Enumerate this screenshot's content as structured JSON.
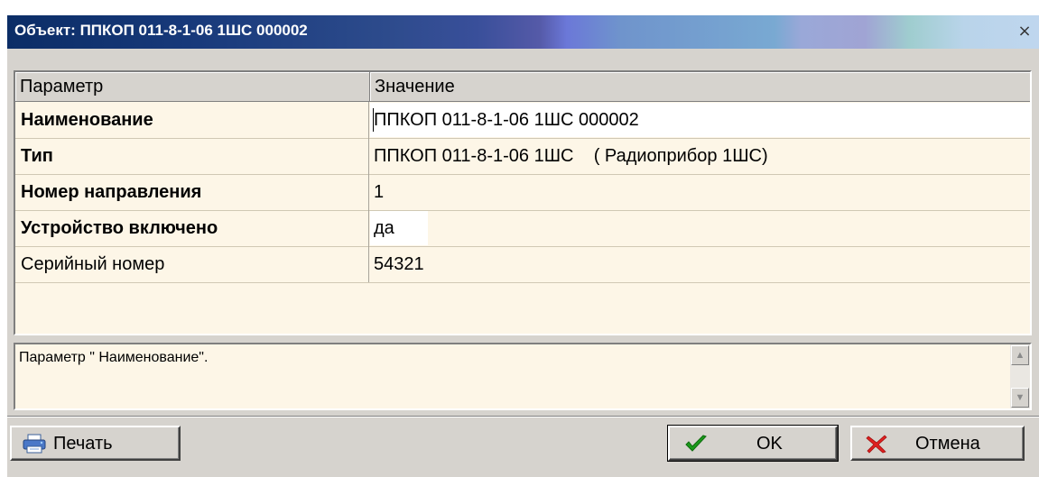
{
  "window": {
    "title": "Объект: ППКОП 011-8-1-06 1ШС 000002",
    "close_glyph": "×"
  },
  "grid": {
    "headers": {
      "param": "Параметр",
      "value": "Значение"
    },
    "rows": [
      {
        "name": "Наименование",
        "value": "ППКОП 011-8-1-06 1ШС 000002"
      },
      {
        "name": "Тип",
        "value": "ППКОП 011-8-1-06 1ШС    ( Радиоприбор 1ШС)"
      },
      {
        "name": "Номер направления",
        "value": "1"
      },
      {
        "name": "Устройство включено",
        "value": "да"
      },
      {
        "name": "Серийный номер",
        "value": "54321"
      }
    ]
  },
  "description": {
    "text": "Параметр \" Наименование\"."
  },
  "buttons": {
    "print_label": "Печать",
    "ok_label": "OK",
    "cancel_label": "Отмена"
  },
  "icons": {
    "print": "printer-icon",
    "ok": "check-icon",
    "cancel": "cross-icon",
    "scroll_up": "scroll-up-arrow",
    "scroll_down": "scroll-down-arrow"
  },
  "colors": {
    "panel": "#d6d3ce",
    "grid_bg": "#fdf6e7",
    "title_dark": "#0b2d66",
    "check_green": "#1a9a1a",
    "cross_red": "#e02020"
  }
}
